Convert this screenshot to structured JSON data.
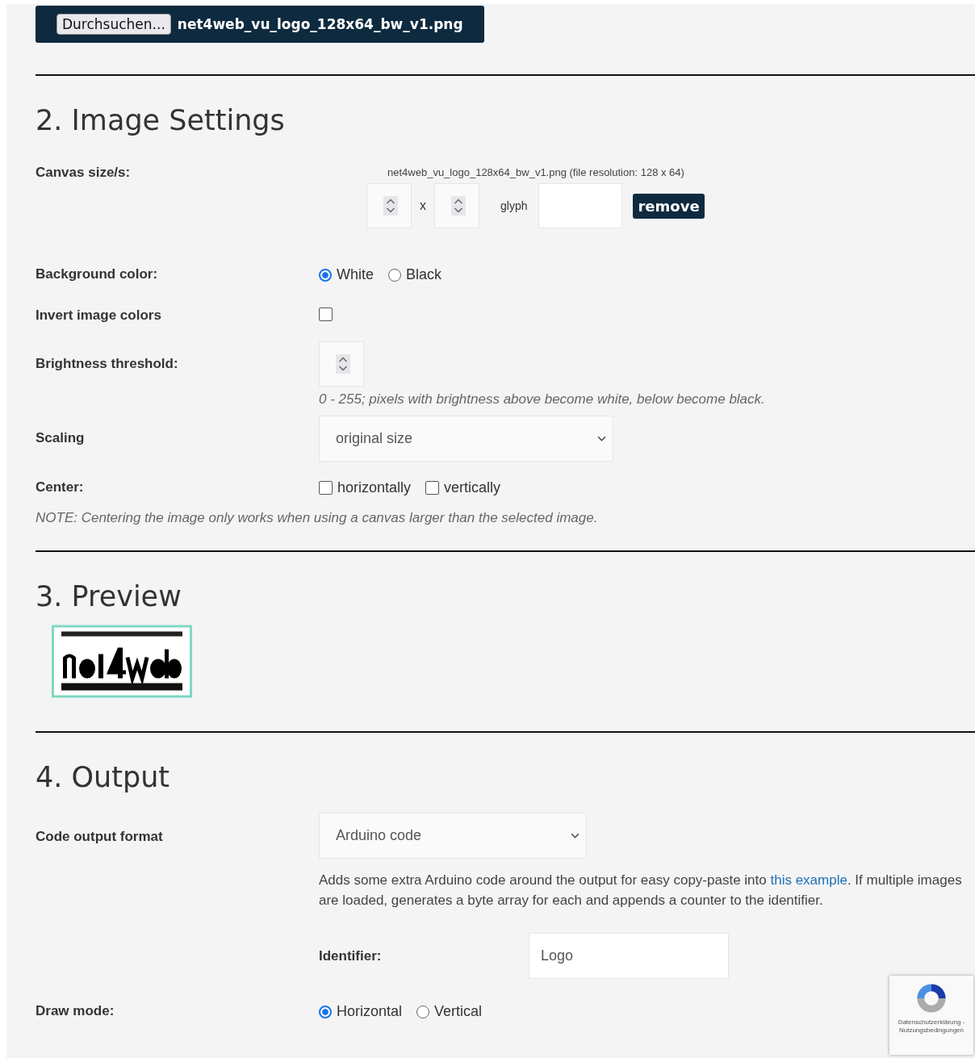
{
  "file_bar": {
    "button": "Durchsuchen...",
    "file_name": "net4web_vu_logo_128x64_bw_v1.png"
  },
  "image_settings": {
    "heading": "2. Image Settings",
    "canvas": {
      "label": "Canvas size/s:",
      "file_info": "net4web_vu_logo_128x64_bw_v1.png  (file resolution: 128 x 64)",
      "separator": "x",
      "glyph_label": "glyph",
      "remove_button": "remove"
    },
    "background": {
      "label": "Background color:",
      "options": [
        {
          "label": "White",
          "selected": true
        },
        {
          "label": "Black",
          "selected": false
        }
      ]
    },
    "invert": {
      "label": "Invert image colors",
      "checked": false
    },
    "brightness": {
      "label": "Brightness threshold:",
      "hint": "0 - 255; pixels with brightness above become white, below become black."
    },
    "scaling": {
      "label": "Scaling",
      "value": "original size"
    },
    "center": {
      "label": "Center:",
      "options": [
        {
          "label": "horizontally",
          "checked": false
        },
        {
          "label": "vertically",
          "checked": false
        }
      ]
    },
    "note": "NOTE: Centering the image only works when using a canvas larger than the selected image."
  },
  "preview": {
    "heading": "3. Preview"
  },
  "output": {
    "heading": "4. Output",
    "format": {
      "label": "Code output format",
      "value": "Arduino code"
    },
    "description": {
      "before": "Adds some extra Arduino code around the output for easy copy-paste into ",
      "link": "this example",
      "after": ". If multiple images are loaded, generates a byte array for each and appends a counter to the identifier."
    },
    "identifier": {
      "label": "Identifier:",
      "value": "Logo"
    },
    "draw_mode": {
      "label": "Draw mode:",
      "options": [
        {
          "label": "Horizontal",
          "selected": true
        },
        {
          "label": "Vertical",
          "selected": false
        }
      ]
    }
  },
  "recaptcha": {
    "text": "Datenschutzerklärung - Nutzungsbedingungen"
  }
}
